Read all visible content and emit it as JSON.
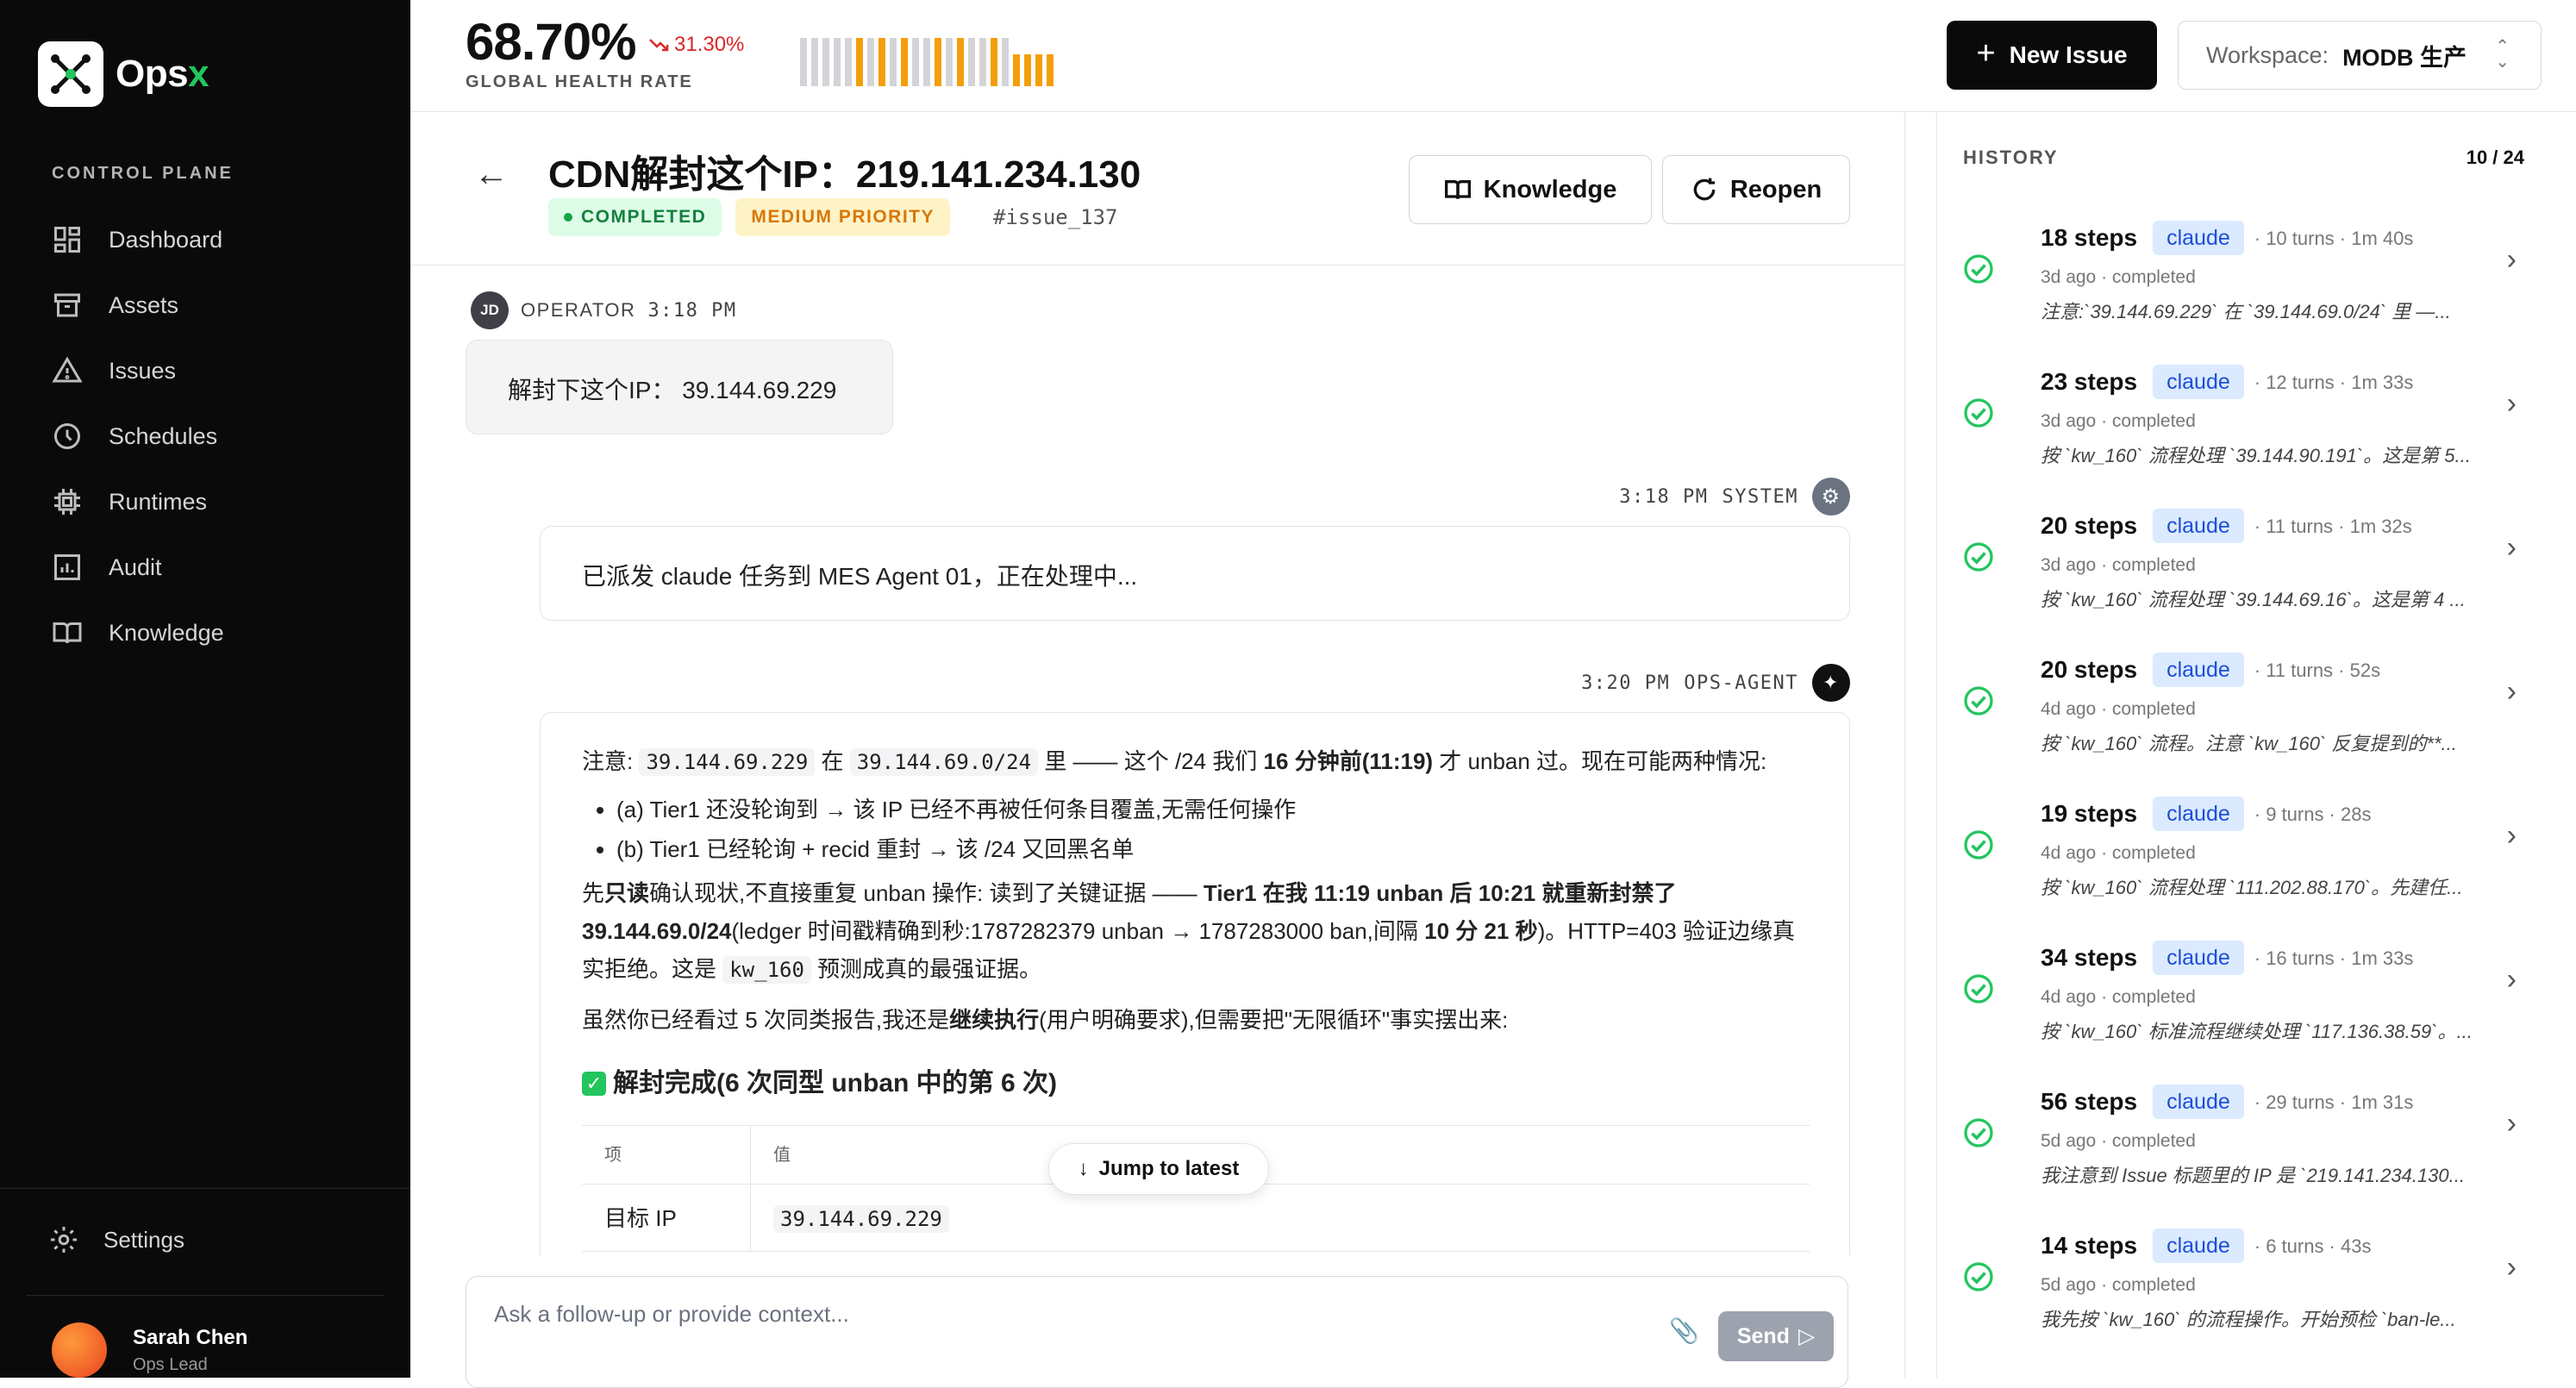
{
  "brand": {
    "name_main": "Ops",
    "name_accent": "x"
  },
  "sidebar": {
    "section_label": "CONTROL PLANE",
    "items": [
      {
        "label": "Dashboard",
        "icon": "dashboard-icon"
      },
      {
        "label": "Assets",
        "icon": "archive-icon"
      },
      {
        "label": "Issues",
        "icon": "warning-icon"
      },
      {
        "label": "Schedules",
        "icon": "clock-icon"
      },
      {
        "label": "Runtimes",
        "icon": "cpu-icon"
      },
      {
        "label": "Audit",
        "icon": "audit-chart-icon"
      },
      {
        "label": "Knowledge",
        "icon": "book-icon"
      }
    ],
    "settings_label": "Settings",
    "user": {
      "name": "Sarah Chen",
      "role": "Ops Lead"
    }
  },
  "topbar": {
    "health_value": "68.70%",
    "health_delta": "31.30%",
    "health_label": "GLOBAL HEALTH RATE",
    "health_bars": [
      {
        "level": 0.9,
        "color": "#d4d4d8"
      },
      {
        "level": 0.9,
        "color": "#d4d4d8"
      },
      {
        "level": 0.9,
        "color": "#d4d4d8"
      },
      {
        "level": 0.9,
        "color": "#d4d4d8"
      },
      {
        "level": 0.9,
        "color": "#d4d4d8"
      },
      {
        "level": 0.9,
        "color": "#f59e0b"
      },
      {
        "level": 0.9,
        "color": "#d4d4d8"
      },
      {
        "level": 0.9,
        "color": "#f59e0b"
      },
      {
        "level": 0.9,
        "color": "#d4d4d8"
      },
      {
        "level": 0.9,
        "color": "#f59e0b"
      },
      {
        "level": 0.9,
        "color": "#d4d4d8"
      },
      {
        "level": 0.9,
        "color": "#d4d4d8"
      },
      {
        "level": 0.9,
        "color": "#f59e0b"
      },
      {
        "level": 0.9,
        "color": "#d4d4d8"
      },
      {
        "level": 0.9,
        "color": "#f59e0b"
      },
      {
        "level": 0.9,
        "color": "#d4d4d8"
      },
      {
        "level": 0.9,
        "color": "#d4d4d8"
      },
      {
        "level": 0.9,
        "color": "#f59e0b"
      },
      {
        "level": 0.9,
        "color": "#d4d4d8"
      },
      {
        "level": 0.6,
        "color": "#f59e0b"
      },
      {
        "level": 0.6,
        "color": "#f59e0b"
      },
      {
        "level": 0.6,
        "color": "#f59e0b"
      },
      {
        "level": 0.6,
        "color": "#f59e0b"
      }
    ],
    "new_issue_label": "New Issue",
    "workspace_label": "Workspace:",
    "workspace_value": "MODB 生产"
  },
  "issue": {
    "title": "CDN解封这个IP：219.141.234.130",
    "status": "COMPLETED",
    "priority": "MEDIUM PRIORITY",
    "id": "#issue_137",
    "knowledge_label": "Knowledge",
    "reopen_label": "Reopen"
  },
  "messages": {
    "operator": {
      "initials": "JD",
      "role": "OPERATOR",
      "time": "3:18 PM",
      "text": "解封下这个IP： 39.144.69.229"
    },
    "system": {
      "time": "3:18 PM",
      "role": "SYSTEM",
      "text": "已派发 claude 任务到 MES Agent 01，正在处理中..."
    },
    "agent": {
      "time": "3:20 PM",
      "role": "OPS-AGENT",
      "p1_a": "注意: ",
      "p1_code1": "39.144.69.229",
      "p1_b": " 在 ",
      "p1_code2": "39.144.69.0/24",
      "p1_c": " 里 —— 这个 /24 我们 ",
      "p1_bold": "16 分钟前(11:19)",
      "p1_d": " 才 unban 过。现在可能两种情况:",
      "bullets": [
        "(a) Tier1 还没轮询到 → 该 IP 已经不再被任何条目覆盖,无需任何操作",
        "(b) Tier1 已经轮询 + recid 重封 → 该 /24 又回黑名单"
      ],
      "p2_a": "先",
      "p2_bold1": "只读",
      "p2_b": "确认现状,不直接重复 unban 操作: 读到了关键证据 —— ",
      "p2_bold2": "Tier1 在我 11:19 unban 后 10:21 就重新封禁了 39.144.69.0/24",
      "p2_c": "(ledger 时间戳精确到秒:1787282379 unban → 1787283000 ban,间隔 ",
      "p2_bold3": "10 分 21 秒",
      "p2_d": ")。HTTP=403 验证边缘真实拒绝。这是 ",
      "p2_code": "kw_160",
      "p2_e": " 预测成真的最强证据。",
      "p3_a": "虽然你已经看过 5 次同类报告,我还是",
      "p3_bold": "继续执行",
      "p3_b": "(用户明确要求),但需要把\"无限循环\"事实摆出来:",
      "done_heading": "解封完成(6 次同型 unban 中的第 6 次)",
      "table": {
        "headers": [
          "项",
          "值"
        ],
        "rows": [
          [
            "目标 IP",
            "39.144.69.229"
          ]
        ]
      }
    },
    "jump_label": "Jump to latest"
  },
  "composer": {
    "placeholder": "Ask a follow-up or provide context...",
    "send_label": "Send"
  },
  "history": {
    "title": "HISTORY",
    "count": "10 / 24",
    "items": [
      {
        "steps": "18 steps",
        "agent": "claude",
        "meta": "· 10 turns · 1m 40s",
        "sub": "3d ago · completed",
        "text": "注意:`39.144.69.229` 在 `39.144.69.0/24` 里 —..."
      },
      {
        "steps": "23 steps",
        "agent": "claude",
        "meta": "· 12 turns · 1m 33s",
        "sub": "3d ago · completed",
        "text": "按 `kw_160` 流程处理 `39.144.90.191`。这是第 5..."
      },
      {
        "steps": "20 steps",
        "agent": "claude",
        "meta": "· 11 turns · 1m 32s",
        "sub": "3d ago · completed",
        "text": "按 `kw_160` 流程处理 `39.144.69.16`。这是第 4 ..."
      },
      {
        "steps": "20 steps",
        "agent": "claude",
        "meta": "· 11 turns · 52s",
        "sub": "4d ago · completed",
        "text": "按 `kw_160` 流程。注意 `kw_160` 反复提到的**..."
      },
      {
        "steps": "19 steps",
        "agent": "claude",
        "meta": "· 9 turns · 28s",
        "sub": "4d ago · completed",
        "text": "按 `kw_160` 流程处理 `111.202.88.170`。先建任..."
      },
      {
        "steps": "34 steps",
        "agent": "claude",
        "meta": "· 16 turns · 1m 33s",
        "sub": "4d ago · completed",
        "text": "按 `kw_160` 标准流程继续处理 `117.136.38.59`。..."
      },
      {
        "steps": "56 steps",
        "agent": "claude",
        "meta": "· 29 turns · 1m 31s",
        "sub": "5d ago · completed",
        "text": "我注意到 Issue 标题里的 IP 是 `219.141.234.130..."
      },
      {
        "steps": "14 steps",
        "agent": "claude",
        "meta": "· 6 turns · 43s",
        "sub": "5d ago · completed",
        "text": "我先按 `kw_160` 的流程操作。开始预检 `ban-le..."
      }
    ]
  }
}
